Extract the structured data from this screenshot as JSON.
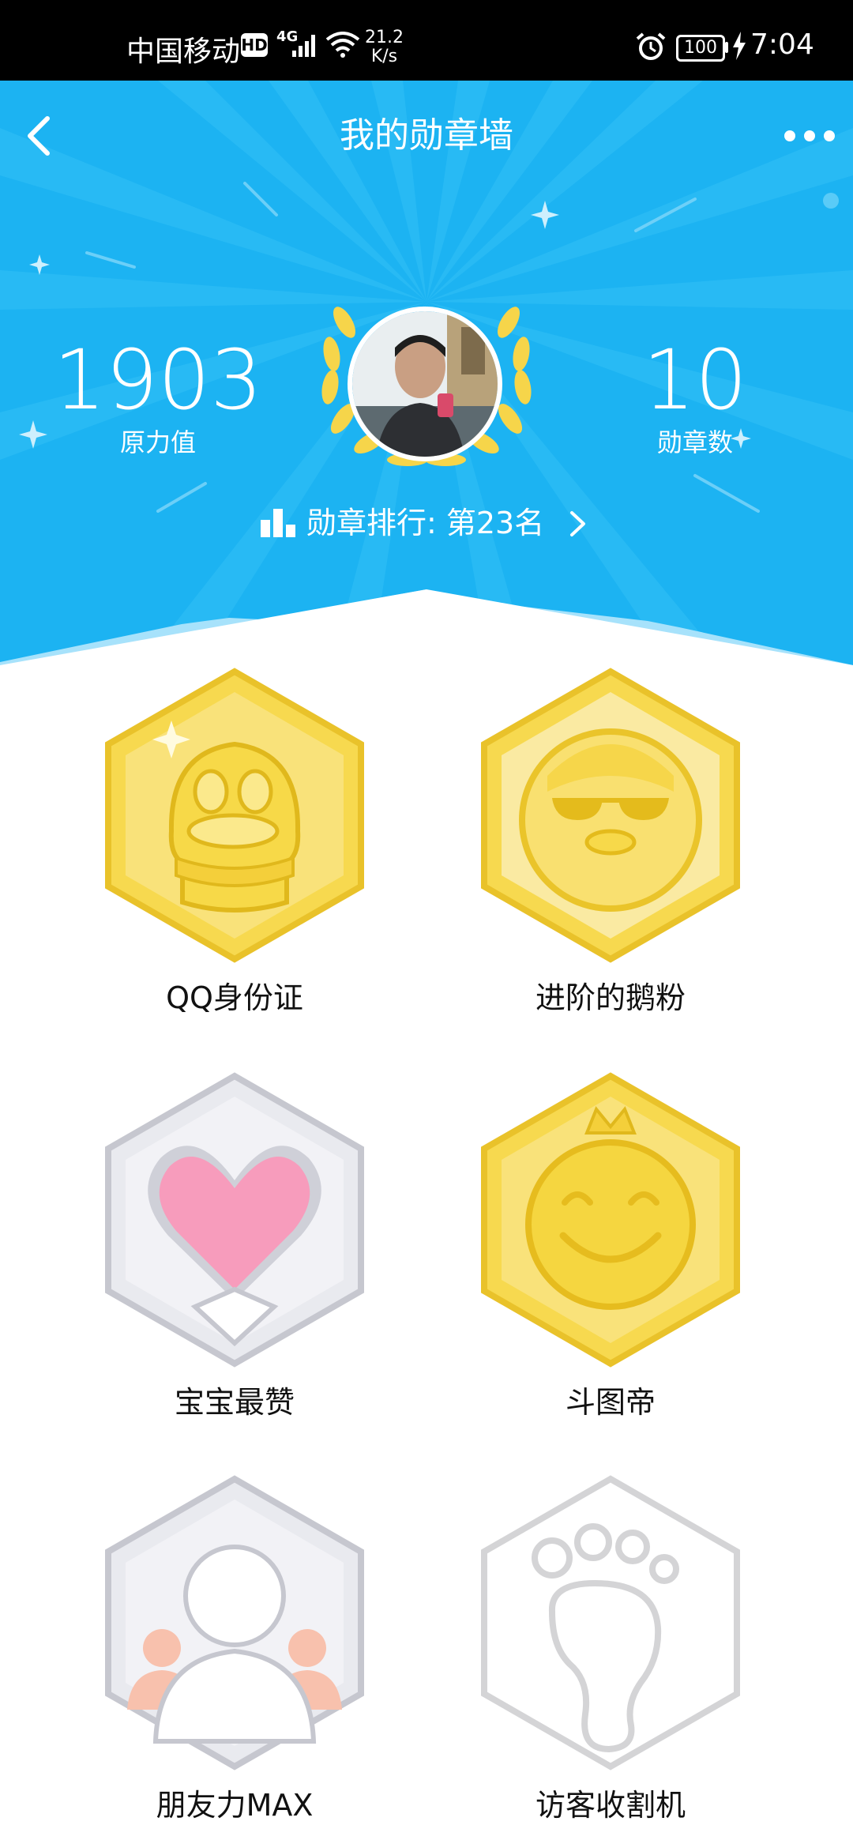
{
  "status_bar": {
    "carrier": "中国移动",
    "hd": "HD",
    "network": "4G",
    "speed_value": "21.2",
    "speed_unit": "K/s",
    "battery": "100",
    "time": "7:04"
  },
  "header": {
    "title": "我的勋章墙",
    "back_icon": "chevron-left-icon",
    "more_icon": "more-dots-icon"
  },
  "stats": {
    "force_value": "1903",
    "force_label": "原力值",
    "medal_count": "10",
    "medal_label": "勋章数"
  },
  "ranking": {
    "text": "勋章排行: 第23名"
  },
  "badges": [
    {
      "label": "QQ身份证",
      "icon": "qq-penguin-scarf-icon",
      "tier": "gold"
    },
    {
      "label": "进阶的鹅粉",
      "icon": "penguin-sunglasses-icon",
      "tier": "gold"
    },
    {
      "label": "宝宝最赞",
      "icon": "heart-icon",
      "tier": "silver"
    },
    {
      "label": "斗图帝",
      "icon": "smiley-crown-icon",
      "tier": "gold"
    },
    {
      "label": "朋友力MAX",
      "icon": "friends-people-icon",
      "tier": "silver"
    },
    {
      "label": "访客收割机",
      "icon": "footprint-icon",
      "tier": "locked"
    }
  ],
  "colors": {
    "header_bg": "#1cb3f2",
    "gold": "#f2d33a",
    "silver": "#c7c8d0"
  }
}
